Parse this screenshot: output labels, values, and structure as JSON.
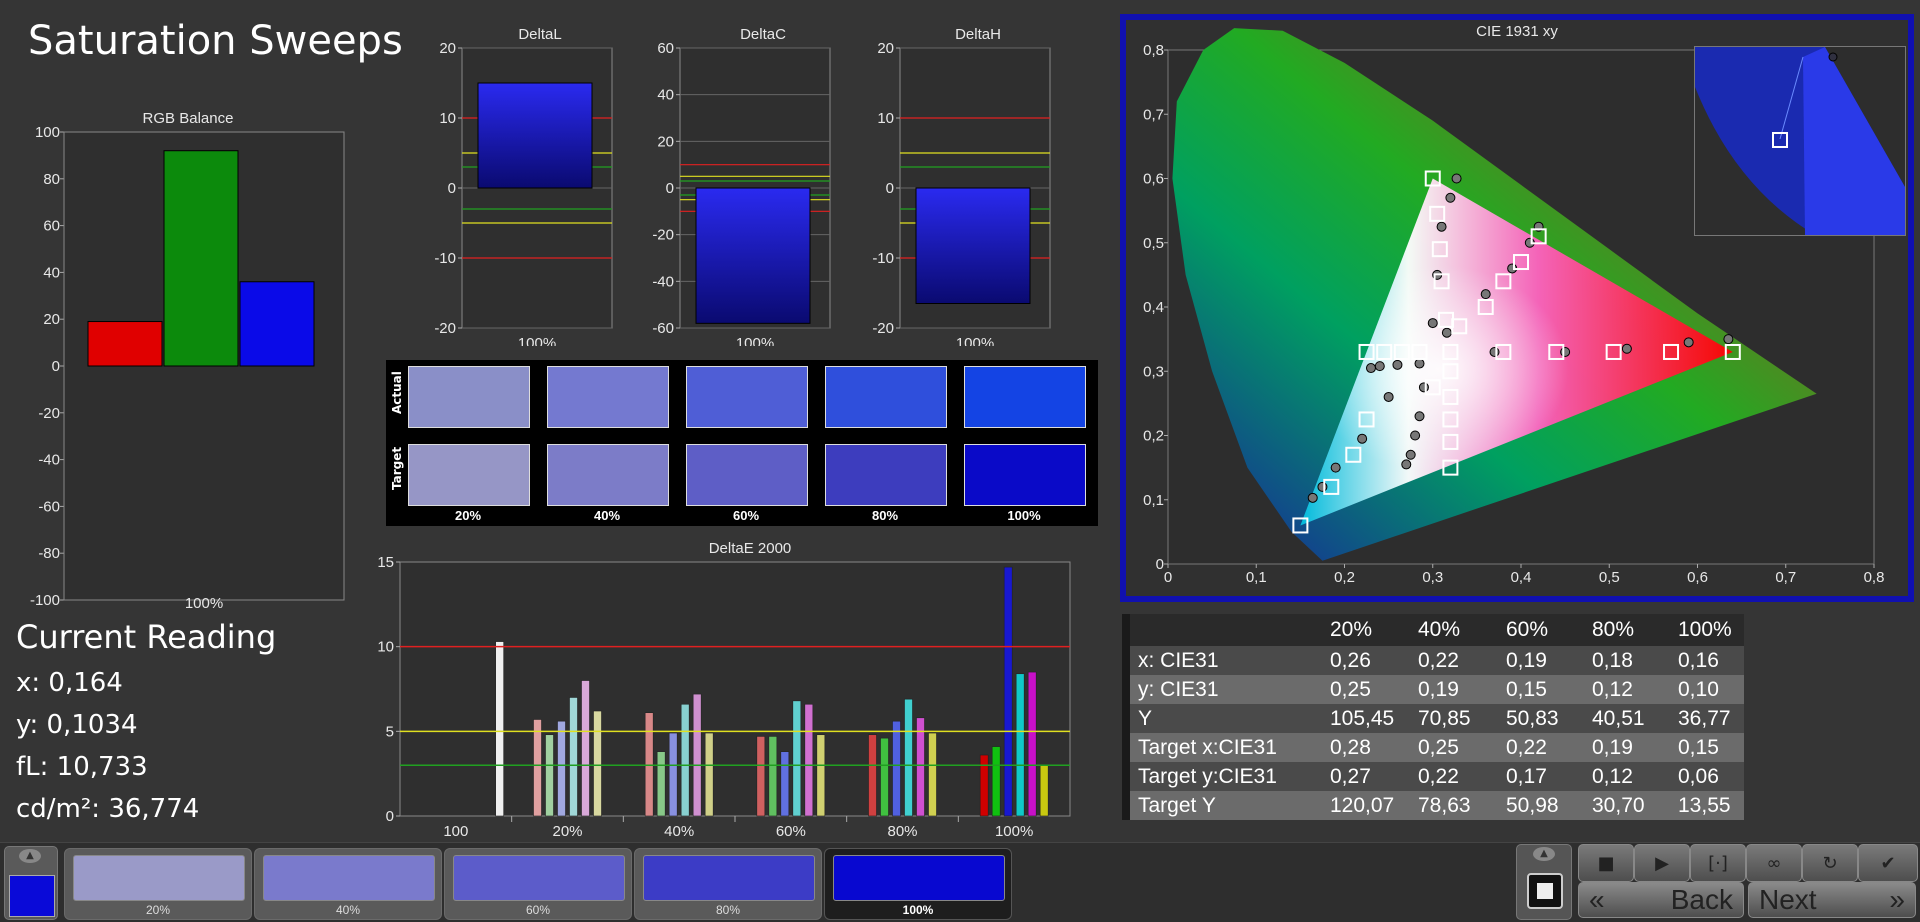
{
  "page": {
    "title": "Saturation Sweeps"
  },
  "rgb_balance": {
    "title": "RGB Balance",
    "xlabel": "100%",
    "yticks": [
      "100",
      "80",
      "60",
      "40",
      "20",
      "0",
      "-20",
      "-40",
      "-60",
      "-80",
      "-100"
    ]
  },
  "delta_l": {
    "title": "DeltaL",
    "xlabel": "100%",
    "yticks": [
      "20",
      "10",
      "0",
      "-10",
      "-20"
    ]
  },
  "delta_c": {
    "title": "DeltaC",
    "xlabel": "100%",
    "yticks": [
      "60",
      "40",
      "20",
      "0",
      "-20",
      "-40",
      "-60"
    ]
  },
  "delta_h": {
    "title": "DeltaH",
    "xlabel": "100%",
    "yticks": [
      "20",
      "10",
      "0",
      "-10",
      "-20"
    ]
  },
  "swatches": {
    "actual_label": "Actual",
    "target_label": "Target",
    "labels": [
      "20%",
      "40%",
      "60%",
      "80%",
      "100%"
    ],
    "actual_colors": [
      "#8a8fc8",
      "#7479d0",
      "#4f5ed6",
      "#2f4fdc",
      "#1444e4"
    ],
    "target_colors": [
      "#9696c6",
      "#7c7cc8",
      "#5e5ec6",
      "#3d3dbe",
      "#0a0ac8"
    ]
  },
  "delta_e": {
    "title": "DeltaE 2000",
    "categories": [
      "100",
      "20%",
      "40%",
      "60%",
      "80%",
      "100%"
    ],
    "yticks": [
      "15",
      "10",
      "5",
      "0"
    ]
  },
  "cie": {
    "title": "CIE 1931 xy",
    "xticks": [
      "0",
      "0,1",
      "0,2",
      "0,3",
      "0,4",
      "0,5",
      "0,6",
      "0,7",
      "0,8"
    ],
    "yticks": [
      "0,8",
      "0,7",
      "0,6",
      "0,5",
      "0,4",
      "0,3",
      "0,2",
      "0,1",
      "0"
    ]
  },
  "current_reading": {
    "heading": "Current Reading",
    "x": "x: 0,164",
    "y": "y: 0,1034",
    "fl": "fL: 10,733",
    "cdm2": "cd/m²: 36,774"
  },
  "table": {
    "columns": [
      "20%",
      "40%",
      "60%",
      "80%",
      "100%"
    ],
    "rows": [
      {
        "label": "x: CIE31",
        "values": [
          "0,26",
          "0,22",
          "0,19",
          "0,18",
          "0,16"
        ]
      },
      {
        "label": "y: CIE31",
        "values": [
          "0,25",
          "0,19",
          "0,15",
          "0,12",
          "0,10"
        ]
      },
      {
        "label": "Y",
        "values": [
          "105,45",
          "70,85",
          "50,83",
          "40,51",
          "36,77"
        ]
      },
      {
        "label": "Target x:CIE31",
        "values": [
          "0,28",
          "0,25",
          "0,22",
          "0,19",
          "0,15"
        ]
      },
      {
        "label": "Target y:CIE31",
        "values": [
          "0,27",
          "0,22",
          "0,17",
          "0,12",
          "0,06"
        ]
      },
      {
        "label": "Target Y",
        "values": [
          "120,07",
          "78,63",
          "50,98",
          "30,70",
          "13,55"
        ]
      }
    ]
  },
  "bottom": {
    "current_color": "#0a0ad8",
    "thumbs": [
      {
        "label": "20%",
        "color": "#9a9ac8"
      },
      {
        "label": "40%",
        "color": "#7a7acc"
      },
      {
        "label": "60%",
        "color": "#5c5cca"
      },
      {
        "label": "80%",
        "color": "#3c3cc6"
      },
      {
        "label": "100%",
        "color": "#0808d0"
      }
    ],
    "back_label": "Back",
    "next_label": "Next"
  },
  "chart_data": [
    {
      "type": "bar",
      "title": "RGB Balance",
      "xlabel": "100%",
      "categories": [
        "R",
        "G",
        "B"
      ],
      "values": [
        19,
        92,
        36
      ],
      "colors": [
        "#e00000",
        "#0c8a0c",
        "#0a0ae8"
      ],
      "ylim": [
        -100,
        100
      ]
    },
    {
      "type": "bar",
      "title": "DeltaL",
      "xlabel": "100%",
      "values": [
        15
      ],
      "ylim": [
        -20,
        20
      ]
    },
    {
      "type": "bar",
      "title": "DeltaC",
      "xlabel": "100%",
      "values": [
        -58
      ],
      "ylim": [
        -60,
        60
      ]
    },
    {
      "type": "bar",
      "title": "DeltaH",
      "xlabel": "100%",
      "values": [
        -16.5
      ],
      "ylim": [
        -20,
        20
      ]
    },
    {
      "type": "bar",
      "title": "DeltaE 2000",
      "categories": [
        "100",
        "20%",
        "40%",
        "60%",
        "80%",
        "100%"
      ],
      "ylim": [
        0,
        15
      ],
      "groups": [
        {
          "category": "100",
          "values": [
            10.3
          ],
          "colors": [
            "#f0f0f0"
          ]
        },
        {
          "category": "20%",
          "values": [
            5.7,
            4.8,
            5.6,
            7.0,
            8.0,
            6.2
          ],
          "colors": [
            "#e0a0a0",
            "#a0d0a0",
            "#a0a8e0",
            "#a0d8d8",
            "#d8a8d8",
            "#d8d8a0"
          ]
        },
        {
          "category": "40%",
          "values": [
            6.1,
            3.8,
            4.9,
            6.6,
            7.2,
            4.9
          ],
          "colors": [
            "#d88888",
            "#88c888",
            "#8890e0",
            "#88d0d0",
            "#d090d0",
            "#d0d088"
          ]
        },
        {
          "category": "60%",
          "values": [
            4.7,
            4.7,
            3.8,
            6.8,
            6.6,
            4.8
          ],
          "colors": [
            "#d06060",
            "#60c060",
            "#6070e0",
            "#60d0d0",
            "#d070d0",
            "#d0d070"
          ]
        },
        {
          "category": "80%",
          "values": [
            4.8,
            4.6,
            5.6,
            6.9,
            5.8,
            4.9
          ],
          "colors": [
            "#d04040",
            "#40c040",
            "#5060e0",
            "#40d0d0",
            "#d050d0",
            "#d0d050"
          ]
        },
        {
          "category": "100%",
          "values": [
            3.6,
            4.1,
            14.7,
            8.4,
            8.5,
            3.0
          ],
          "colors": [
            "#d00000",
            "#10c010",
            "#1818d0",
            "#10c8c8",
            "#c810c8",
            "#c8c810"
          ]
        }
      ],
      "reference_lines": [
        {
          "y": 10,
          "color": "#e02020"
        },
        {
          "y": 5,
          "color": "#e0e020"
        },
        {
          "y": 3,
          "color": "#20a020"
        }
      ]
    },
    {
      "type": "scatter",
      "title": "CIE 1931 xy",
      "xlim": [
        0,
        0.8
      ],
      "ylim": [
        0,
        0.8
      ],
      "series": [
        {
          "marker": "square",
          "points": [
            [
              0.15,
              0.06
            ],
            [
              0.185,
              0.12
            ],
            [
              0.21,
              0.17
            ],
            [
              0.225,
              0.225
            ],
            [
              0.245,
              0.33
            ],
            [
              0.225,
              0.33
            ],
            [
              0.265,
              0.33
            ],
            [
              0.285,
              0.33
            ],
            [
              0.3,
              0.6
            ],
            [
              0.305,
              0.545
            ],
            [
              0.308,
              0.49
            ],
            [
              0.31,
              0.44
            ],
            [
              0.315,
              0.38
            ],
            [
              0.32,
              0.33
            ],
            [
              0.32,
              0.3
            ],
            [
              0.32,
              0.26
            ],
            [
              0.32,
              0.225
            ],
            [
              0.32,
              0.19
            ],
            [
              0.32,
              0.15
            ],
            [
              0.3,
              0.275
            ],
            [
              0.33,
              0.37
            ],
            [
              0.36,
              0.4
            ],
            [
              0.38,
              0.44
            ],
            [
              0.4,
              0.47
            ],
            [
              0.42,
              0.51
            ],
            [
              0.38,
              0.33
            ],
            [
              0.44,
              0.33
            ],
            [
              0.505,
              0.33
            ],
            [
              0.57,
              0.33
            ],
            [
              0.64,
              0.33
            ]
          ]
        },
        {
          "marker": "circle",
          "points": [
            [
              0.164,
              0.103
            ],
            [
              0.175,
              0.12
            ],
            [
              0.19,
              0.15
            ],
            [
              0.22,
              0.195
            ],
            [
              0.275,
              0.17
            ],
            [
              0.27,
              0.155
            ],
            [
              0.28,
              0.2
            ],
            [
              0.285,
              0.23
            ],
            [
              0.29,
              0.275
            ],
            [
              0.25,
              0.26
            ],
            [
              0.23,
              0.305
            ],
            [
              0.24,
              0.308
            ],
            [
              0.26,
              0.31
            ],
            [
              0.285,
              0.312
            ],
            [
              0.3,
              0.375
            ],
            [
              0.305,
              0.45
            ],
            [
              0.31,
              0.525
            ],
            [
              0.32,
              0.57
            ],
            [
              0.327,
              0.6
            ],
            [
              0.37,
              0.33
            ],
            [
              0.45,
              0.33
            ],
            [
              0.52,
              0.335
            ],
            [
              0.59,
              0.345
            ],
            [
              0.635,
              0.35
            ],
            [
              0.36,
              0.42
            ],
            [
              0.39,
              0.46
            ],
            [
              0.41,
              0.5
            ],
            [
              0.42,
              0.525
            ],
            [
              0.316,
              0.36
            ]
          ]
        }
      ]
    }
  ]
}
